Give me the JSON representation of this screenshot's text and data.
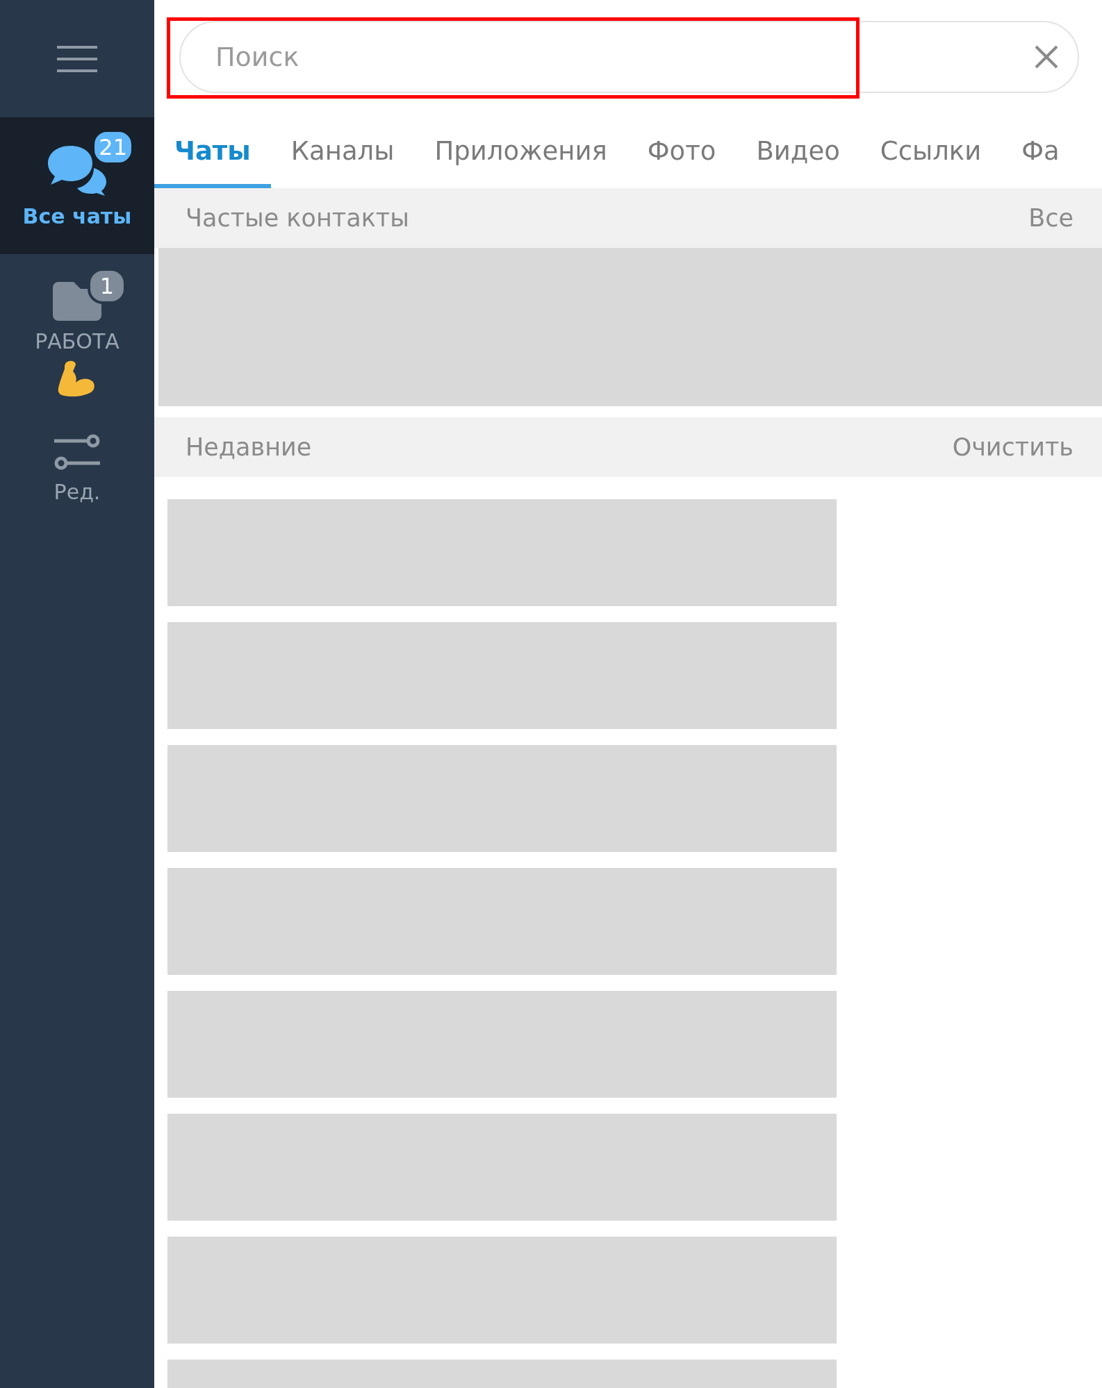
{
  "sidebar": {
    "items": [
      {
        "kind": "chats",
        "label": "Все чаты",
        "badge": "21",
        "selected": true
      },
      {
        "kind": "folder",
        "label": "РАБОТА",
        "emoji": true,
        "badge": "1",
        "selected": false
      },
      {
        "kind": "edit",
        "label": "Ред.",
        "selected": false
      }
    ]
  },
  "search": {
    "placeholder": "Поиск",
    "highlighted": true
  },
  "tabs": [
    {
      "label": "Чаты",
      "selected": true
    },
    {
      "label": "Каналы",
      "selected": false
    },
    {
      "label": "Приложения",
      "selected": false
    },
    {
      "label": "Фото",
      "selected": false
    },
    {
      "label": "Видео",
      "selected": false
    },
    {
      "label": "Ссылки",
      "selected": false
    },
    {
      "label": "Фа",
      "selected": false
    }
  ],
  "frequent": {
    "title": "Частые контакты",
    "action": "Все"
  },
  "recent": {
    "title": "Недавние",
    "action": "Очистить",
    "items": [
      {
        "kind": "skeleton"
      },
      {
        "kind": "skeleton"
      },
      {
        "kind": "skeleton"
      },
      {
        "kind": "skeleton"
      },
      {
        "kind": "skeleton"
      },
      {
        "kind": "skeleton"
      },
      {
        "kind": "skeleton"
      },
      {
        "kind": "skeleton"
      }
    ]
  }
}
